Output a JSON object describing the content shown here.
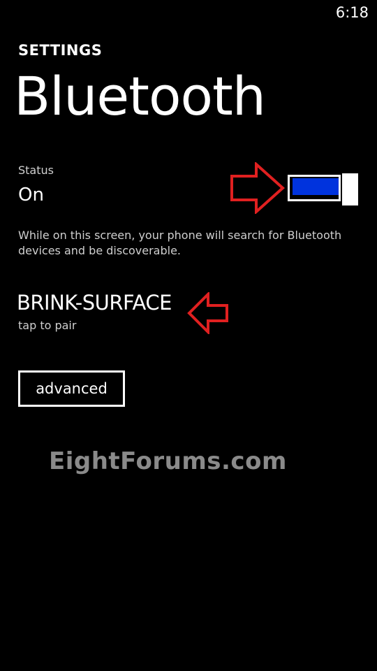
{
  "status_bar": {
    "time": "6:18"
  },
  "header": {
    "app_title": "SETTINGS",
    "page_title": "Bluetooth"
  },
  "status": {
    "label": "Status",
    "value": "On",
    "toggle_on": true
  },
  "description": "While on this screen, your phone will search for Bluetooth devices and be discoverable.",
  "device": {
    "name": "BRINK-SURFACE",
    "subtitle": "tap to pair"
  },
  "buttons": {
    "advanced_label": "advanced"
  },
  "watermark": "EightForums.com",
  "colors": {
    "background": "#000000",
    "accent": "#0033dd",
    "annotation_arrow": "#e02020",
    "secondary_text": "#cfcfcf"
  },
  "icons": {
    "annotation_arrows": [
      "arrow-right-icon",
      "arrow-left-icon"
    ]
  }
}
